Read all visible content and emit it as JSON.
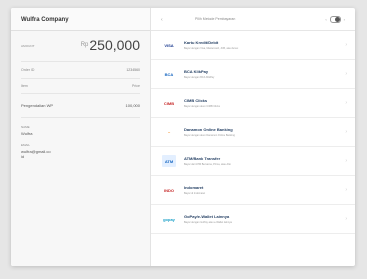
{
  "left": {
    "company": "Wulfra Company",
    "amount_label": "Amount",
    "currency": "Rp",
    "amount": "250,000",
    "order_label": "Order ID",
    "order_value": "1234560",
    "item_header": "Item",
    "price_header": "Price",
    "item_name": "Pengendalian WP",
    "item_price": "100,000",
    "name_label": "Name",
    "name_value": "Wulfra",
    "email_label": "Email",
    "email_value": "wulfra@gmail.co",
    "email_extra": "id"
  },
  "right": {
    "title": "PIlih Metode Pembayaran",
    "payments": [
      {
        "name": "Kartu Kredit/Debit",
        "desc": "Bayar dengan Visa, Mastercard, JCB, atau Amex",
        "logo": "VISA",
        "logo_color": "#1a3a8f",
        "logo_bg": "#ffffff"
      },
      {
        "name": "BCA KlikPay",
        "desc": "Bayar dengan BCA KlikPay",
        "logo": "BCA",
        "logo_color": "#1565c0",
        "logo_bg": "#ffffff"
      },
      {
        "name": "CIMB Clicks",
        "desc": "Bayar dengan akun CIMB Clicks",
        "logo": "CIMB",
        "logo_color": "#c62828",
        "logo_bg": "#ffffff"
      },
      {
        "name": "Danamon Online Banking",
        "desc": "Bayar dengan akun Danamon Online Banking",
        "logo": "~",
        "logo_color": "#f57c00",
        "logo_bg": "#ffffff"
      },
      {
        "name": "ATM/Bank Transfer",
        "desc": "Bayar dari ATM Bersama, Prima, atau Alto",
        "logo": "ATM",
        "logo_color": "#1565c0",
        "logo_bg": "#e3efff"
      },
      {
        "name": "Indomaret",
        "desc": "Bayar di Indomaret",
        "logo": "INDO",
        "logo_color": "#c62828",
        "logo_bg": "#ffffff"
      },
      {
        "name": "GoPay/e-Wallet Lainnya",
        "desc": "Bayar dengan GoPay atau e-Wallet lainnya",
        "logo": "gopay",
        "logo_color": "#1aa0c8",
        "logo_bg": "#ffffff"
      }
    ]
  }
}
